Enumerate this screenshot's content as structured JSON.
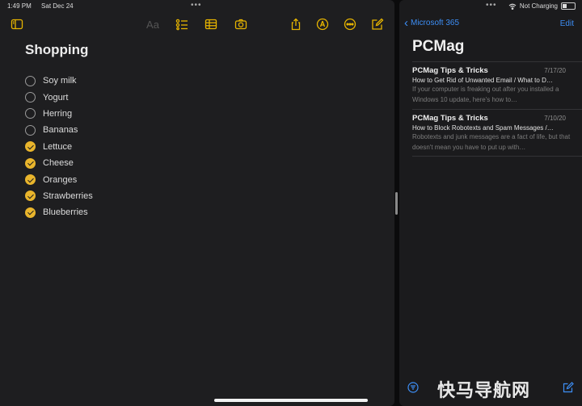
{
  "status": {
    "time": "1:49 PM",
    "date": "Sat Dec 24",
    "charging": "Not Charging"
  },
  "notes": {
    "title": "Shopping",
    "format_label": "Aa",
    "items": [
      {
        "label": "Soy milk",
        "checked": false
      },
      {
        "label": "Yogurt",
        "checked": false
      },
      {
        "label": "Herring",
        "checked": false
      },
      {
        "label": "Bananas",
        "checked": false
      },
      {
        "label": "Lettuce",
        "checked": true
      },
      {
        "label": "Cheese",
        "checked": true
      },
      {
        "label": "Oranges",
        "checked": true
      },
      {
        "label": "Strawberries",
        "checked": true
      },
      {
        "label": "Blueberries",
        "checked": true
      }
    ]
  },
  "mail": {
    "back_label": "Microsoft 365",
    "edit_label": "Edit",
    "mailbox": "PCMag",
    "messages": [
      {
        "sender": "PCMag Tips & Tricks",
        "date": "7/17/20",
        "subject": "How to Get Rid of Unwanted Email / What to D…",
        "preview": "If your computer is freaking out after you installed a Windows 10 update, here's how to…"
      },
      {
        "sender": "PCMag Tips & Tricks",
        "date": "7/10/20",
        "subject": "How to Block Robotexts and Spam Messages /…",
        "preview": "Robotexts and junk messages are a fact of life, but that doesn't mean you have to put up with…"
      }
    ],
    "watermark": "快马导航网"
  },
  "colors": {
    "accent_notes": "#e9b52c",
    "accent_mail": "#3d8ef5"
  }
}
